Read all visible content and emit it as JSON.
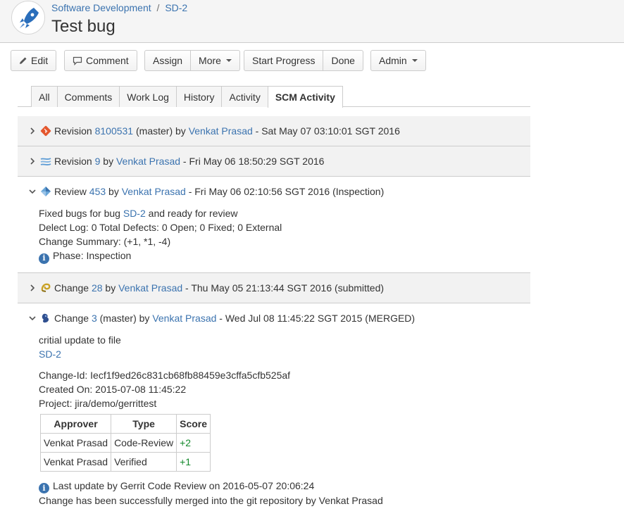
{
  "breadcrumb": {
    "project": "Software Development",
    "separator": "/",
    "issue_key": "SD-2"
  },
  "issue": {
    "title": "Test bug"
  },
  "toolbar": {
    "edit": "Edit",
    "comment": "Comment",
    "assign": "Assign",
    "more": "More",
    "start_progress": "Start Progress",
    "done": "Done",
    "admin": "Admin"
  },
  "tabs": [
    "All",
    "Comments",
    "Work Log",
    "History",
    "Activity",
    "SCM Activity"
  ],
  "active_tab": "SCM Activity",
  "entries": [
    {
      "label": "Revision",
      "id": "8100531",
      "branch": "(master)",
      "by": "by",
      "author": "Venkat Prasad",
      "date": "- Sat May 07 03:10:01 SGT 2016",
      "icon": "git-icon"
    },
    {
      "label": "Revision",
      "id": "9",
      "by": "by",
      "author": "Venkat Prasad",
      "date": "- Fri May 06 18:50:29 SGT 2016",
      "icon": "subversion-icon"
    },
    {
      "label": "Review",
      "id": "453",
      "by": "by",
      "author": "Venkat Prasad",
      "date": "- Fri May 06 02:10:56 SGT 2016 (Inspection)",
      "icon": "review-icon",
      "body": {
        "line1_prefix": "Fixed bugs for bug",
        "line1_link": "SD-2",
        "line1_suffix": "and ready for review",
        "line2": "Delect Log: 0 Total Defects: 0 Open; 0 Fixed; 0 External",
        "line3": "Change Summary: (+1, *1, -4)",
        "line4": "Phase: Inspection"
      }
    },
    {
      "label": "Change",
      "id": "28",
      "by": "by",
      "author": "Venkat Prasad",
      "date": "- Thu May 05 21:13:44 SGT 2016 (submitted)",
      "icon": "perforce-icon"
    },
    {
      "label": "Change",
      "id": "3",
      "branch": "(master)",
      "by": "by",
      "author": "Venkat Prasad",
      "date": "- Wed Jul 08 11:45:22 SGT 2015 (MERGED)",
      "icon": "gerrit-icon",
      "body": {
        "message": "critial update to file",
        "issue_link": "SD-2",
        "change_id": "Change-Id: Iecf1f9ed26c831cb68fb88459e3cffa5cfb525af",
        "created_on": "Created On: 2015-07-08 11:45:22",
        "project": "Project: jira/demo/gerrittest",
        "table": {
          "headers": [
            "Approver",
            "Type",
            "Score"
          ],
          "rows": [
            [
              "Venkat Prasad",
              "Code-Review",
              "+2"
            ],
            [
              "Venkat Prasad",
              "Verified",
              "+1"
            ]
          ]
        },
        "last_update": "Last update by Gerrit Code Review on 2016-05-07 20:06:24",
        "merge_note": "Change has been successfully merged into the git repository by Venkat Prasad"
      }
    }
  ],
  "colors": {
    "link": "#3b73af",
    "positive_score": "#14892c",
    "info": "#3b73af"
  }
}
